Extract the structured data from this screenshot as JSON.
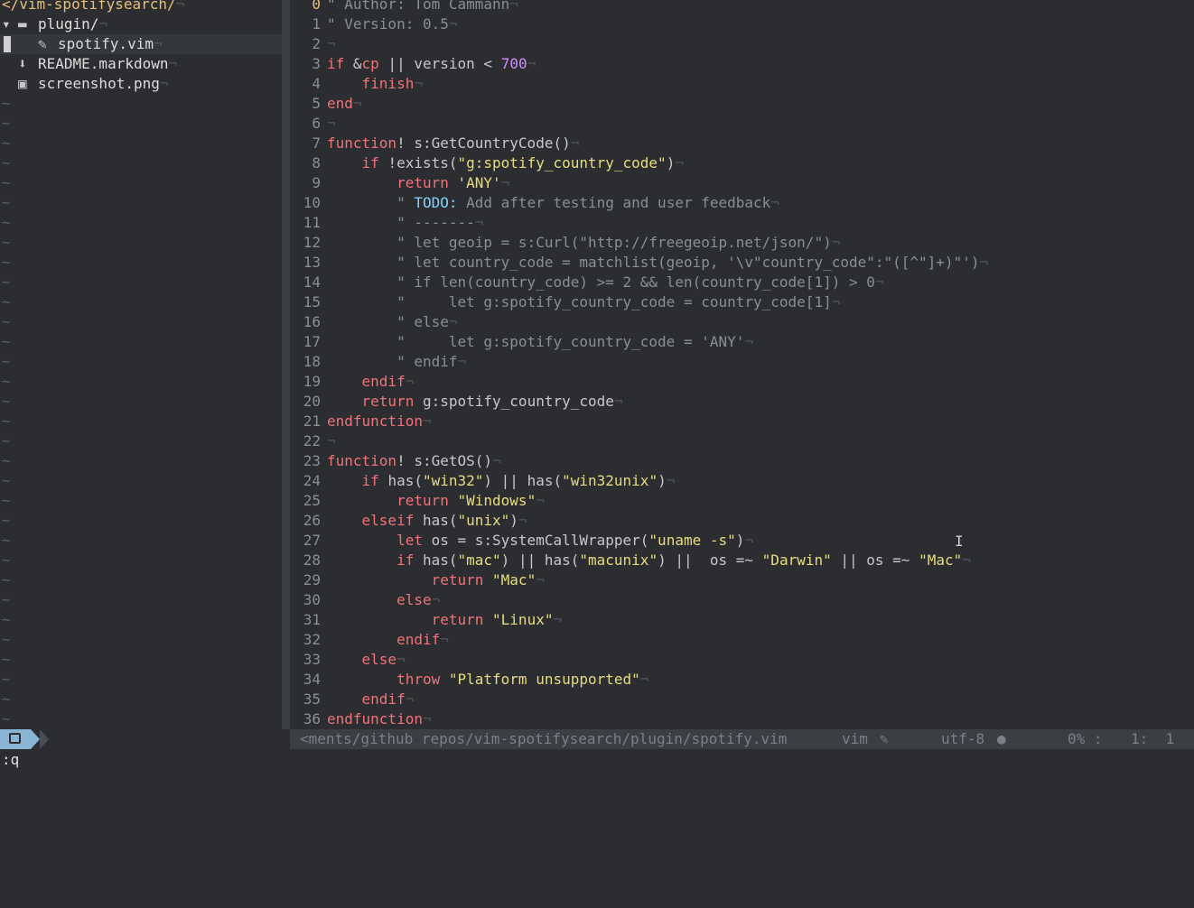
{
  "nerdtree": {
    "root": "</vim-spotifysearch/",
    "items": [
      {
        "kind": "dir",
        "arrow": "▾",
        "name": "plugin/"
      },
      {
        "kind": "file",
        "name": "spotify.vim",
        "icon": "vim-file-icon"
      },
      {
        "kind": "file",
        "name": "README.markdown",
        "icon": "markdown-icon"
      },
      {
        "kind": "file",
        "name": "screenshot.png",
        "icon": "image-icon"
      }
    ],
    "eol_marker": "¬",
    "tilde": "~"
  },
  "editor": {
    "lines": [
      {
        "n": "0",
        "t": [
          [
            "c",
            "\" Author: "
          ],
          [
            "c",
            "Tom Cammann"
          ]
        ]
      },
      {
        "n": "1",
        "t": [
          [
            "c",
            "\" Version: 0.5"
          ]
        ]
      },
      {
        "n": "2",
        "t": []
      },
      {
        "n": "3",
        "t": [
          [
            "k",
            "if "
          ],
          [
            "o",
            "&"
          ],
          [
            "k",
            "cp"
          ],
          [
            "o",
            " || "
          ],
          [
            "f",
            "version"
          ],
          [
            "o",
            " < "
          ],
          [
            "n",
            "700"
          ]
        ]
      },
      {
        "n": "4",
        "t": [
          [
            "o",
            "    "
          ],
          [
            "k",
            "finish"
          ]
        ]
      },
      {
        "n": "5",
        "t": [
          [
            "k",
            "end"
          ]
        ]
      },
      {
        "n": "6",
        "t": []
      },
      {
        "n": "7",
        "t": [
          [
            "k",
            "function"
          ],
          [
            "o",
            "! s:GetCountryCode()"
          ]
        ]
      },
      {
        "n": "8",
        "t": [
          [
            "o",
            "    "
          ],
          [
            "k",
            "if "
          ],
          [
            "o",
            "!exists("
          ],
          [
            "s",
            "\"g:spotify_country_code\""
          ],
          [
            "o",
            ")"
          ]
        ]
      },
      {
        "n": "9",
        "t": [
          [
            "o",
            "        "
          ],
          [
            "k",
            "return "
          ],
          [
            "s",
            "'ANY'"
          ]
        ]
      },
      {
        "n": "10",
        "t": [
          [
            "o",
            "        "
          ],
          [
            "c",
            "\" "
          ],
          [
            "todo",
            "TODO:"
          ],
          [
            "c",
            " Add after testing and user feedback"
          ]
        ]
      },
      {
        "n": "11",
        "t": [
          [
            "o",
            "        "
          ],
          [
            "c",
            "\" -------"
          ]
        ]
      },
      {
        "n": "12",
        "t": [
          [
            "o",
            "        "
          ],
          [
            "c",
            "\" let geoip = s:Curl(\"http://freegeoip.net/json/\")"
          ]
        ]
      },
      {
        "n": "13",
        "t": [
          [
            "o",
            "        "
          ],
          [
            "c",
            "\" let country_code = matchlist(geoip, '\\v\"country_code\":\"([^\"]+)\"')"
          ]
        ]
      },
      {
        "n": "14",
        "t": [
          [
            "o",
            "        "
          ],
          [
            "c",
            "\" if len(country_code) >= 2 && len(country_code[1]) > 0"
          ]
        ]
      },
      {
        "n": "15",
        "t": [
          [
            "o",
            "        "
          ],
          [
            "c",
            "\"     let g:spotify_country_code = country_code[1]"
          ]
        ]
      },
      {
        "n": "16",
        "t": [
          [
            "o",
            "        "
          ],
          [
            "c",
            "\" else"
          ]
        ]
      },
      {
        "n": "17",
        "t": [
          [
            "o",
            "        "
          ],
          [
            "c",
            "\"     let g:spotify_country_code = 'ANY'"
          ]
        ]
      },
      {
        "n": "18",
        "t": [
          [
            "o",
            "        "
          ],
          [
            "c",
            "\" endif"
          ]
        ]
      },
      {
        "n": "19",
        "t": [
          [
            "o",
            "    "
          ],
          [
            "k",
            "endif"
          ]
        ]
      },
      {
        "n": "20",
        "t": [
          [
            "o",
            "    "
          ],
          [
            "k",
            "return "
          ],
          [
            "o",
            "g:spotify_country_code"
          ]
        ]
      },
      {
        "n": "21",
        "t": [
          [
            "k",
            "endfunction"
          ]
        ]
      },
      {
        "n": "22",
        "t": []
      },
      {
        "n": "23",
        "t": [
          [
            "k",
            "function"
          ],
          [
            "o",
            "! s:GetOS()"
          ]
        ]
      },
      {
        "n": "24",
        "t": [
          [
            "o",
            "    "
          ],
          [
            "k",
            "if "
          ],
          [
            "o",
            "has("
          ],
          [
            "s",
            "\"win32\""
          ],
          [
            "o",
            ") || has("
          ],
          [
            "s",
            "\"win32unix\""
          ],
          [
            "o",
            ")"
          ]
        ]
      },
      {
        "n": "25",
        "t": [
          [
            "o",
            "        "
          ],
          [
            "k",
            "return "
          ],
          [
            "s",
            "\"Windows\""
          ]
        ]
      },
      {
        "n": "26",
        "t": [
          [
            "o",
            "    "
          ],
          [
            "k",
            "elseif "
          ],
          [
            "o",
            "has("
          ],
          [
            "s",
            "\"unix\""
          ],
          [
            "o",
            ")"
          ]
        ]
      },
      {
        "n": "27",
        "t": [
          [
            "o",
            "        "
          ],
          [
            "k",
            "let "
          ],
          [
            "o",
            "os = s:SystemCallWrapper("
          ],
          [
            "s",
            "\"uname -s\""
          ],
          [
            "o",
            ")"
          ]
        ]
      },
      {
        "n": "28",
        "t": [
          [
            "o",
            "        "
          ],
          [
            "k",
            "if "
          ],
          [
            "o",
            "has("
          ],
          [
            "s",
            "\"mac\""
          ],
          [
            "o",
            ") || has("
          ],
          [
            "s",
            "\"macunix\""
          ],
          [
            "o",
            ") ||  os =~ "
          ],
          [
            "s",
            "\"Darwin\""
          ],
          [
            "o",
            " || os =~ "
          ],
          [
            "s",
            "\"Mac\""
          ]
        ]
      },
      {
        "n": "29",
        "t": [
          [
            "o",
            "            "
          ],
          [
            "k",
            "return "
          ],
          [
            "s",
            "\"Mac\""
          ]
        ]
      },
      {
        "n": "30",
        "t": [
          [
            "o",
            "        "
          ],
          [
            "k",
            "else"
          ]
        ]
      },
      {
        "n": "31",
        "t": [
          [
            "o",
            "            "
          ],
          [
            "k",
            "return "
          ],
          [
            "s",
            "\"Linux\""
          ]
        ]
      },
      {
        "n": "32",
        "t": [
          [
            "o",
            "        "
          ],
          [
            "k",
            "endif"
          ]
        ]
      },
      {
        "n": "33",
        "t": [
          [
            "o",
            "    "
          ],
          [
            "k",
            "else"
          ]
        ]
      },
      {
        "n": "34",
        "t": [
          [
            "o",
            "        "
          ],
          [
            "k",
            "throw "
          ],
          [
            "s",
            "\"Platform unsupported\""
          ]
        ]
      },
      {
        "n": "35",
        "t": [
          [
            "o",
            "    "
          ],
          [
            "k",
            "endif"
          ]
        ]
      },
      {
        "n": "36",
        "t": [
          [
            "k",
            "endfunction"
          ]
        ]
      }
    ],
    "current_line": "0",
    "eol_marker": "¬"
  },
  "statusline": {
    "mode_icon": "nerdtree-icon",
    "path": "<ments/github repos/vim-spotifysearch/plugin/spotify.vim",
    "filetype": "vim",
    "filetype_icon": "vim-icon",
    "encoding": "utf-8",
    "os_icon": "apple-icon",
    "percent": "0% :",
    "position": "1:  1"
  },
  "cmdline": ":q",
  "colors": {
    "background": "#2b2d30",
    "keyword": "#f0727a",
    "string": "#e6dd82",
    "number": "#d08fff",
    "comment": "#8a8f96",
    "todo": "#7fd3ff",
    "directory": "#e5c07b"
  }
}
